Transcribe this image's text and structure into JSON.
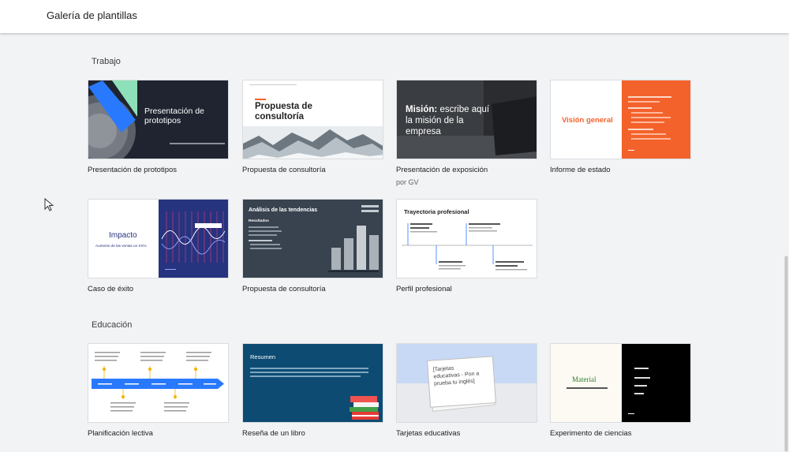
{
  "header": {
    "title": "Galería de plantillas"
  },
  "sections": [
    {
      "title": "Trabajo"
    },
    {
      "title": "Educación"
    }
  ],
  "templates": [
    {
      "caption": "Presentación de prototipos",
      "thumb_title": "Presentación de prototipos",
      "thumb_line1": "Presentación de",
      "thumb_line2": "prototipos"
    },
    {
      "caption": "Propuesta de consultoría",
      "thumb_line1": "Propuesta de",
      "thumb_line2": "consultoría"
    },
    {
      "caption": "Presentación de exposición",
      "author": "por GV",
      "thumb_bold": "Misión:",
      "thumb_line1": "escribe aquí",
      "thumb_line2": "la misión de la",
      "thumb_line3": "empresa"
    },
    {
      "caption": "Informe de estado",
      "thumb_title": "Visión general"
    },
    {
      "caption": "Caso de éxito",
      "thumb_title": "Impacto",
      "thumb_sub": "Aumento de las ventas un XX%"
    },
    {
      "caption": "Propuesta de consultoría",
      "thumb_title": "Análisis de las tendencias",
      "thumb_sub": "Resultados"
    },
    {
      "caption": "Perfil profesional",
      "thumb_title": "Trayectoria profesional"
    },
    {
      "caption": "Planificación lectiva"
    },
    {
      "caption": "Reseña de un libro",
      "thumb_title": "Resumen"
    },
    {
      "caption": "Tarjetas educativas",
      "thumb_line1": "[Tarjetas",
      "thumb_line2": "educativas - Pon a",
      "thumb_line3": "prueba tu inglés]"
    },
    {
      "caption": "Experimento de ciencias",
      "thumb_title": "Material"
    }
  ],
  "colors": {
    "orange": "#f4622b",
    "navy": "#26337f",
    "teal": "#0d4b73",
    "dark": "#1f2430",
    "slate": "#38434f",
    "mint": "#8ee0b8",
    "blue": "#2979ff"
  },
  "icons": {
    "cursor": "mouse-pointer-icon"
  }
}
